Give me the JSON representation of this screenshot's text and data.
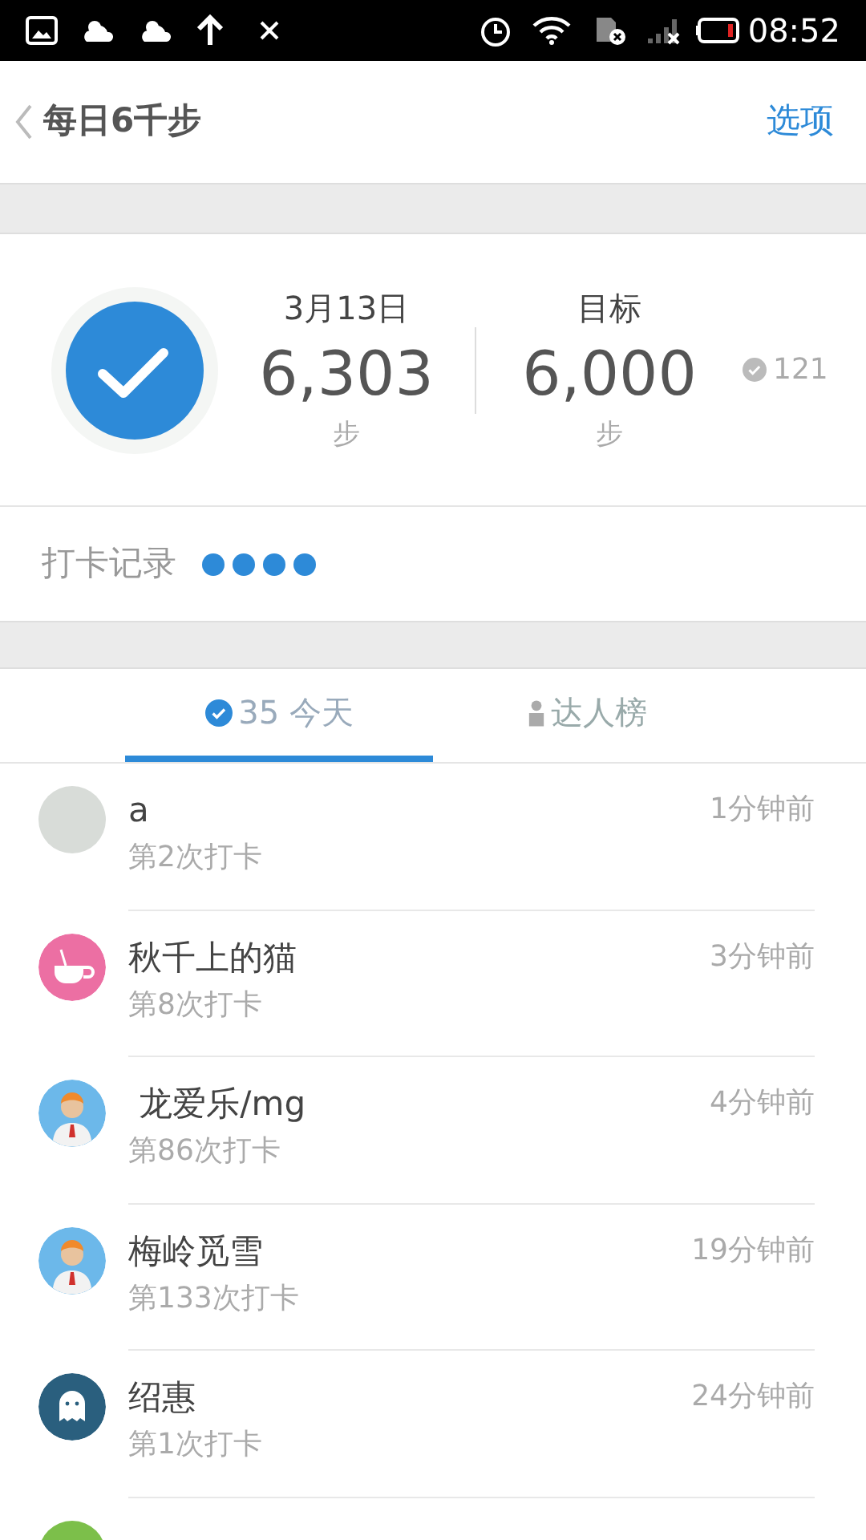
{
  "status_bar": {
    "time": "08:52"
  },
  "header": {
    "title": "每日6千步",
    "action": "选项"
  },
  "summary": {
    "completed": true,
    "date": "3月13日",
    "steps": "6,303",
    "steps_unit": "步",
    "goal_label": "目标",
    "goal": "6,000",
    "goal_unit": "步",
    "checkins": "121"
  },
  "record": {
    "label": "打卡记录",
    "dots": [
      {
        "done": true
      },
      {
        "done": true
      },
      {
        "done": true
      },
      {
        "done": true
      }
    ]
  },
  "tabs": [
    {
      "kind": "check",
      "label": "35 今天",
      "selected": true
    },
    {
      "kind": "person",
      "label": "达人榜",
      "selected": false
    }
  ],
  "rows": [
    {
      "kind": "photo",
      "name": "a",
      "sub": "第2次打卡",
      "time": "1分钟前"
    },
    {
      "kind": "cup",
      "name": "秋千上的猫",
      "sub": "第8次打卡",
      "time": "3分钟前"
    },
    {
      "kind": "man",
      "name": " 龙爱乐/mg",
      "sub": "第86次打卡",
      "time": "4分钟前"
    },
    {
      "kind": "man",
      "name": "梅岭觅雪",
      "sub": "第133次打卡",
      "time": "19分钟前"
    },
    {
      "kind": "ghost",
      "name": "绍惠",
      "sub": "第1次打卡",
      "time": "24分钟前"
    },
    {
      "kind": "green"
    }
  ]
}
